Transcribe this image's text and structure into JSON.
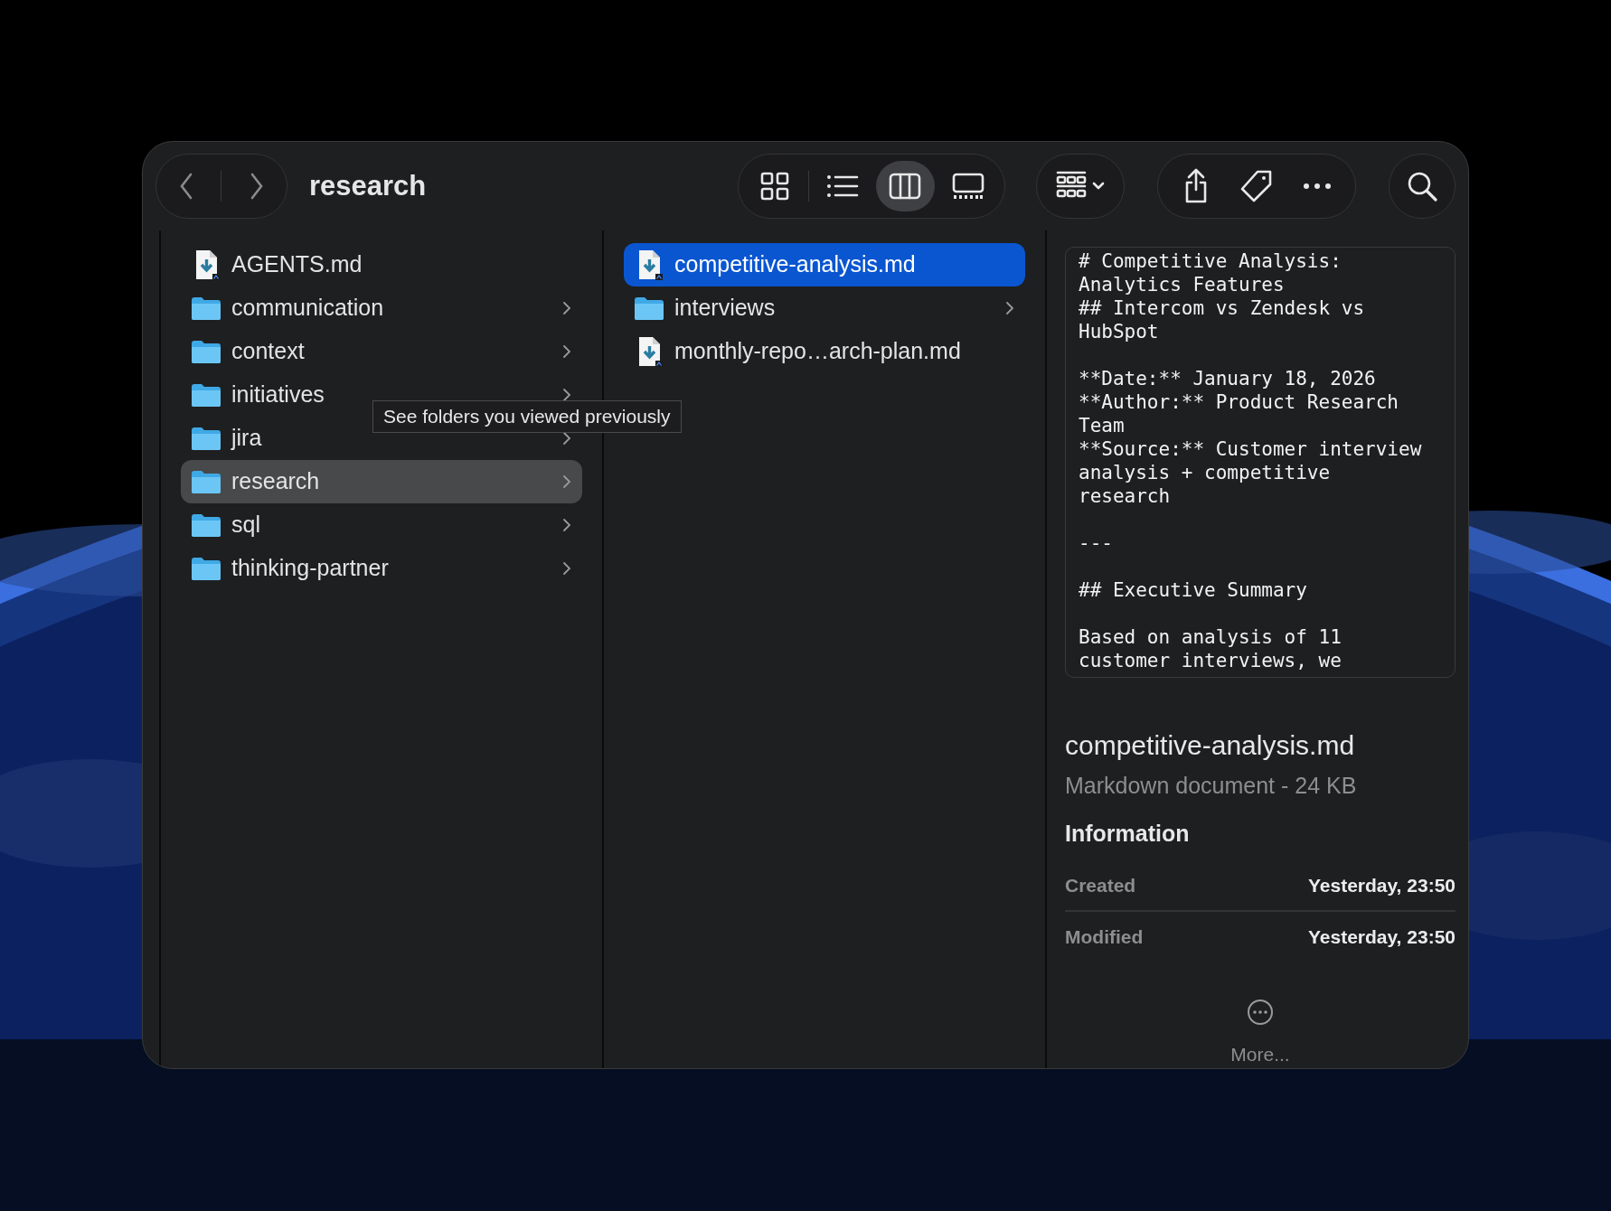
{
  "window": {
    "title": "research"
  },
  "toolbar": {
    "view_modes": [
      {
        "kind": "icons",
        "selected": false
      },
      {
        "kind": "list",
        "selected": false
      },
      {
        "kind": "columns",
        "selected": true
      },
      {
        "kind": "gallery",
        "selected": false
      }
    ]
  },
  "columns": [
    {
      "active": false,
      "items": [
        {
          "name": "AGENTS.md",
          "kind": "file",
          "selected": false
        },
        {
          "name": "communication",
          "kind": "folder",
          "selected": false
        },
        {
          "name": "context",
          "kind": "folder",
          "selected": false
        },
        {
          "name": "initiatives",
          "kind": "folder",
          "selected": false
        },
        {
          "name": "jira",
          "kind": "folder",
          "selected": false
        },
        {
          "name": "research",
          "kind": "folder",
          "selected": true
        },
        {
          "name": "sql",
          "kind": "folder",
          "selected": false
        },
        {
          "name": "thinking-partner",
          "kind": "folder",
          "selected": false
        }
      ]
    },
    {
      "active": true,
      "items": [
        {
          "name": "competitive-analysis.md",
          "kind": "file",
          "selected": true
        },
        {
          "name": "interviews",
          "kind": "folder",
          "selected": false
        },
        {
          "name": "monthly-repo…arch-plan.md",
          "kind": "file",
          "selected": false
        }
      ]
    }
  ],
  "tooltip": "See folders you viewed previously",
  "preview": {
    "text": "# Competitive Analysis:\nAnalytics Features\n## Intercom vs Zendesk vs\nHubSpot\n\n**Date:** January 18, 2026\n**Author:** Product Research\nTeam\n**Source:** Customer interview\nanalysis + competitive\nresearch\n\n---\n\n## Executive Summary\n\nBased on analysis of 11\ncustomer interviews, we",
    "name": "competitive-analysis.md",
    "kind_size": "Markdown document - 24 KB",
    "section": "Information",
    "info": [
      {
        "label": "Created",
        "value": "Yesterday, 23:50"
      },
      {
        "label": "Modified",
        "value": "Yesterday, 23:50"
      }
    ],
    "more": "More..."
  }
}
